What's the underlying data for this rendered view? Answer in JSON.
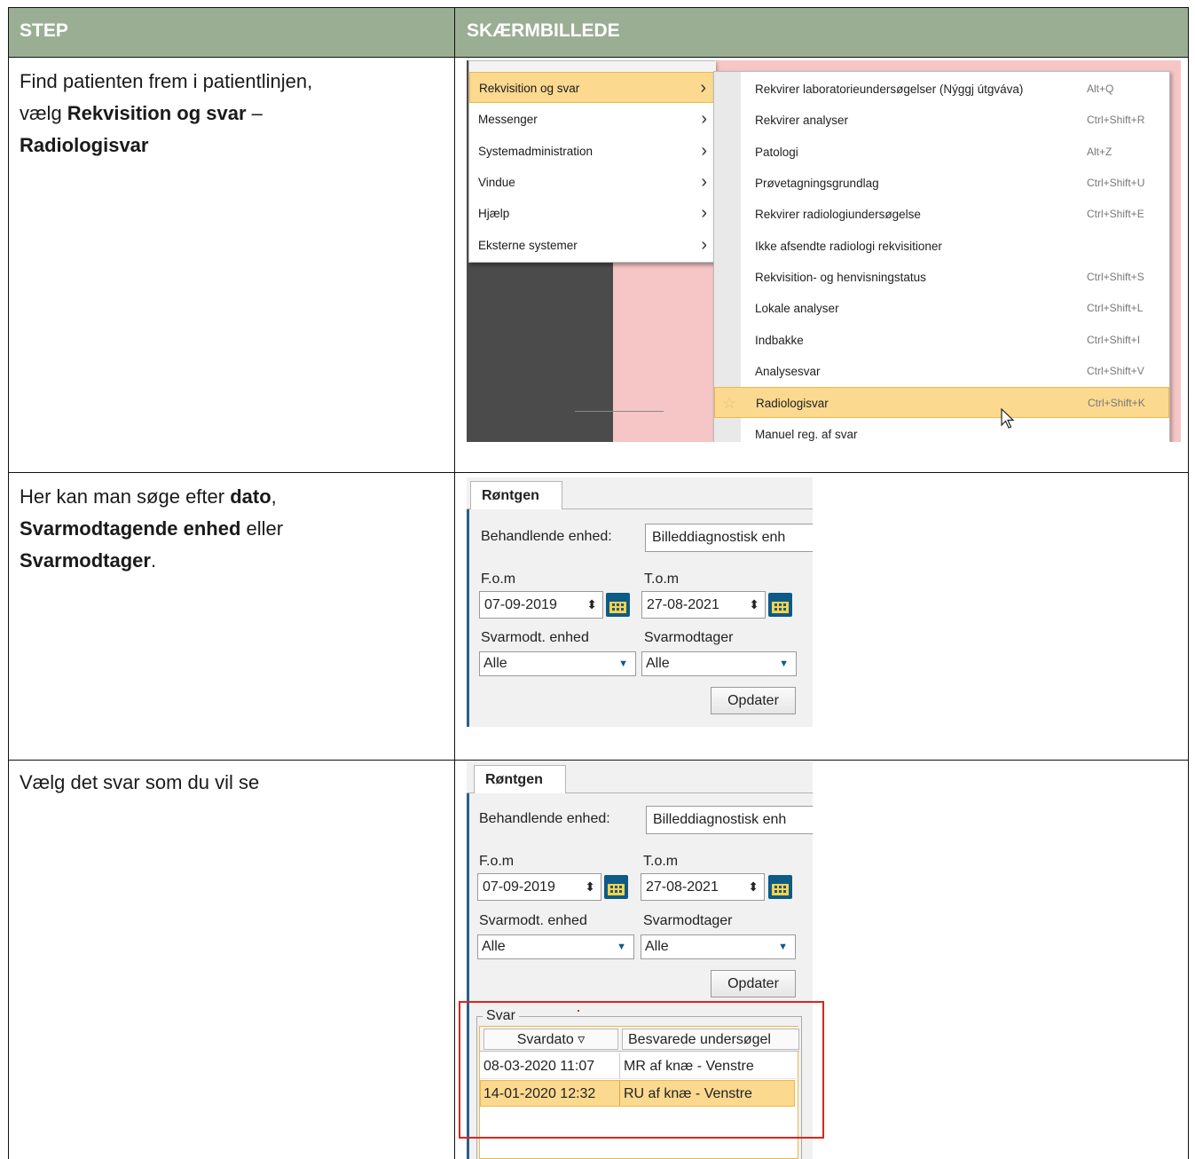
{
  "header": {
    "step": "STEP",
    "screenshot": "SKÆRMBILLEDE"
  },
  "rows": [
    {
      "text": {
        "line1": "Find patienten frem i patientlinjen,",
        "line2_pre": "vælg ",
        "line2_bold": "Rekvisition og svar",
        "line2_post": " –",
        "line3_bold": "Radiologisvar"
      }
    },
    {
      "text": {
        "line1_pre": "Her kan man søge efter ",
        "line1_bold": "dato",
        "line1_post": ",",
        "line2_bold": "Svarmodtagende enhed",
        "line2_post": " eller",
        "line3_bold": "Svarmodtager",
        "line3_post": "."
      }
    },
    {
      "text": {
        "line1": "Vælg det svar som du vil se"
      }
    }
  ],
  "menu": {
    "items": [
      {
        "label": "Rekvisition og svar"
      },
      {
        "label": "Messenger"
      },
      {
        "label": "Systemadministration"
      },
      {
        "label": "Vindue"
      },
      {
        "label": "Hjælp"
      },
      {
        "label": "Eksterne systemer"
      }
    ],
    "chevron": "›",
    "submenu": [
      {
        "label": "Rekvirer laboratorieundersøgelser (Nýggj útgváva)",
        "shortcut": "Alt+Q"
      },
      {
        "label": "Rekvirer analyser",
        "shortcut": "Ctrl+Shift+R"
      },
      {
        "label": "Patologi",
        "shortcut": "Alt+Z"
      },
      {
        "label": "Prøvetagningsgrundlag",
        "shortcut": "Ctrl+Shift+U"
      },
      {
        "label": "Rekvirer radiologiundersøgelse",
        "shortcut": "Ctrl+Shift+E"
      },
      {
        "label": "Ikke afsendte radiologi rekvisitioner",
        "shortcut": ""
      },
      {
        "label": "Rekvisition- og henvisningstatus",
        "shortcut": "Ctrl+Shift+S"
      },
      {
        "label": "Lokale analyser",
        "shortcut": "Ctrl+Shift+L"
      },
      {
        "label": "Indbakke",
        "shortcut": "Ctrl+Shift+I"
      },
      {
        "label": "Analysesvar",
        "shortcut": "Ctrl+Shift+V"
      },
      {
        "label": "Radiologisvar",
        "shortcut": "Ctrl+Shift+K"
      },
      {
        "label": "Manuel reg. af svar",
        "shortcut": ""
      }
    ],
    "star_icon": "☆",
    "cursor_icon": "cursor-arrow"
  },
  "form": {
    "tab": "Røntgen",
    "behandlende_label": "Behandlende enhed:",
    "behandlende_value": "Billeddiagnostisk enh",
    "fom_label": "F.o.m",
    "fom_value": "07-09-2019",
    "tom_label": "T.o.m",
    "tom_value": "27-08-2021",
    "svarmodt_enhed_label": "Svarmodt. enhed",
    "svarmodt_enhed_value": "Alle",
    "svarmodtager_label": "Svarmodtager",
    "svarmodtager_value": "Alle",
    "opdater": "Opdater",
    "spinner_icon": "⬍",
    "dropdown_icon": "▼"
  },
  "results": {
    "group_label": "Svar",
    "columns": [
      "Svardato ▿",
      "Besvarede undersøgel"
    ],
    "rows": [
      [
        "08-03-2020 11:07",
        "MR af knæ - Venstre"
      ],
      [
        "14-01-2020 12:32",
        "RU af knæ - Venstre"
      ]
    ],
    "highlight_color": "#e0231c"
  }
}
